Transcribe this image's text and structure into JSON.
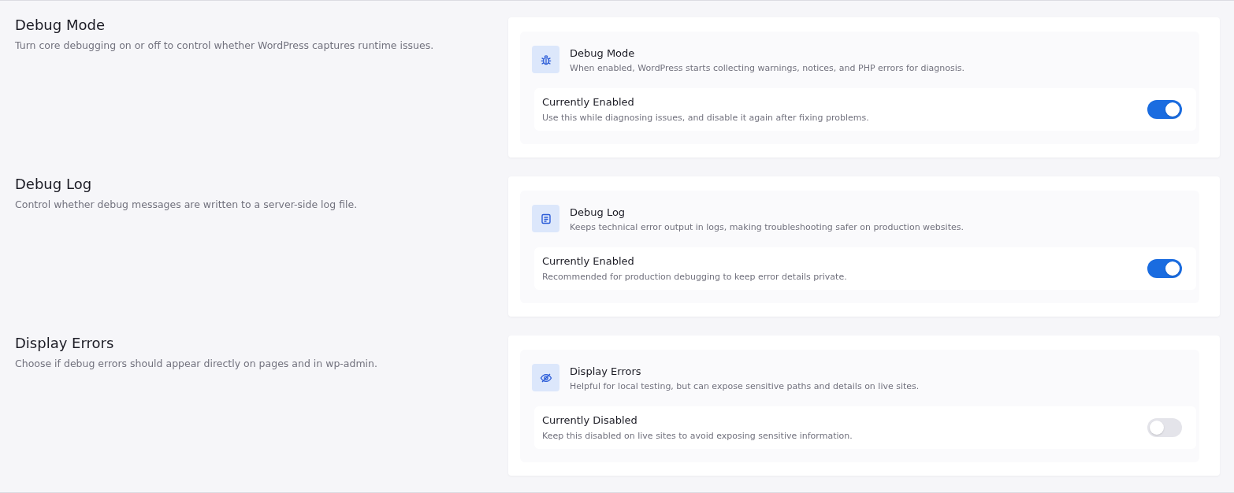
{
  "sections": [
    {
      "title": "Debug Mode",
      "description": "Turn core debugging on or off to control whether WordPress captures runtime issues.",
      "card": {
        "kind": "mode",
        "title": "Debug Mode",
        "description": "When enabled, WordPress starts collecting warnings, notices, and PHP errors for diagnosis.",
        "status": {
          "label": "Currently Enabled",
          "description": "Use this while diagnosing issues, and disable it again after fixing problems.",
          "on": true
        }
      }
    },
    {
      "title": "Debug Log",
      "description": "Control whether debug messages are written to a server-side log file.",
      "card": {
        "kind": "log",
        "title": "Debug Log",
        "description": "Keeps technical error output in logs, making troubleshooting safer on production websites.",
        "status": {
          "label": "Currently Enabled",
          "description": "Recommended for production debugging to keep error details private.",
          "on": true
        }
      }
    },
    {
      "title": "Display Errors",
      "description": "Choose if debug errors should appear directly on pages and in wp-admin.",
      "card": {
        "kind": "display",
        "title": "Display Errors",
        "description": "Helpful for local testing, but can expose sensitive paths and details on live sites.",
        "status": {
          "label": "Currently Disabled",
          "description": "Keep this disabled on live sites to avoid exposing sensitive information.",
          "on": false
        }
      }
    }
  ]
}
